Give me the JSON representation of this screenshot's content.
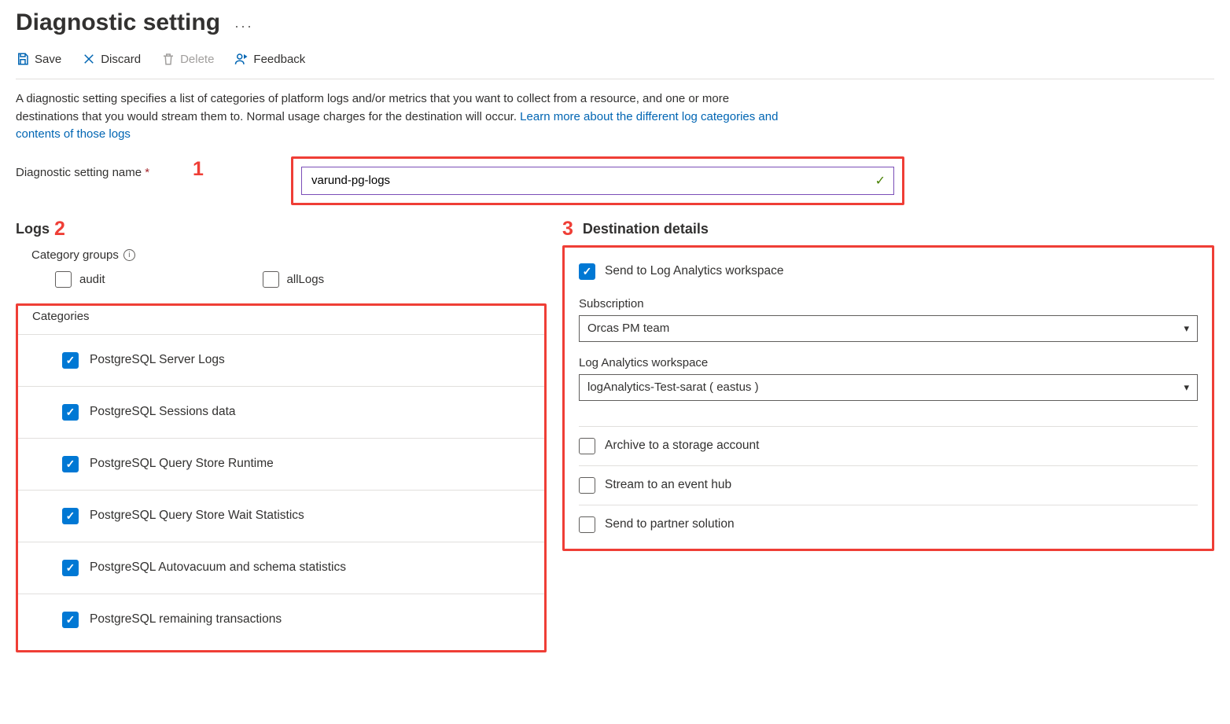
{
  "header": {
    "title": "Diagnostic setting"
  },
  "toolbar": {
    "save": "Save",
    "discard": "Discard",
    "delete": "Delete",
    "feedback": "Feedback"
  },
  "intro": {
    "text": "A diagnostic setting specifies a list of categories of platform logs and/or metrics that you want to collect from a resource, and one or more destinations that you would stream them to. Normal usage charges for the destination will occur. ",
    "link": "Learn more about the different log categories and contents of those logs"
  },
  "nameField": {
    "label": "Diagnostic setting name",
    "value": "varund-pg-logs"
  },
  "annotations": {
    "one": "1",
    "two": "2",
    "three": "3"
  },
  "logs": {
    "heading": "Logs",
    "categoryGroupsLabel": "Category groups",
    "groups": {
      "audit": "audit",
      "allLogs": "allLogs"
    },
    "categoriesLabel": "Categories",
    "categories": [
      "PostgreSQL Server Logs",
      "PostgreSQL Sessions data",
      "PostgreSQL Query Store Runtime",
      "PostgreSQL Query Store Wait Statistics",
      "PostgreSQL Autovacuum and schema statistics",
      "PostgreSQL remaining transactions"
    ]
  },
  "destinations": {
    "heading": "Destination details",
    "sendLA": "Send to Log Analytics workspace",
    "subscriptionLabel": "Subscription",
    "subscriptionValue": "Orcas PM team",
    "workspaceLabel": "Log Analytics workspace",
    "workspaceValue": "logAnalytics-Test-sarat ( eastus )",
    "archive": "Archive to a storage account",
    "stream": "Stream to an event hub",
    "partner": "Send to partner solution"
  }
}
